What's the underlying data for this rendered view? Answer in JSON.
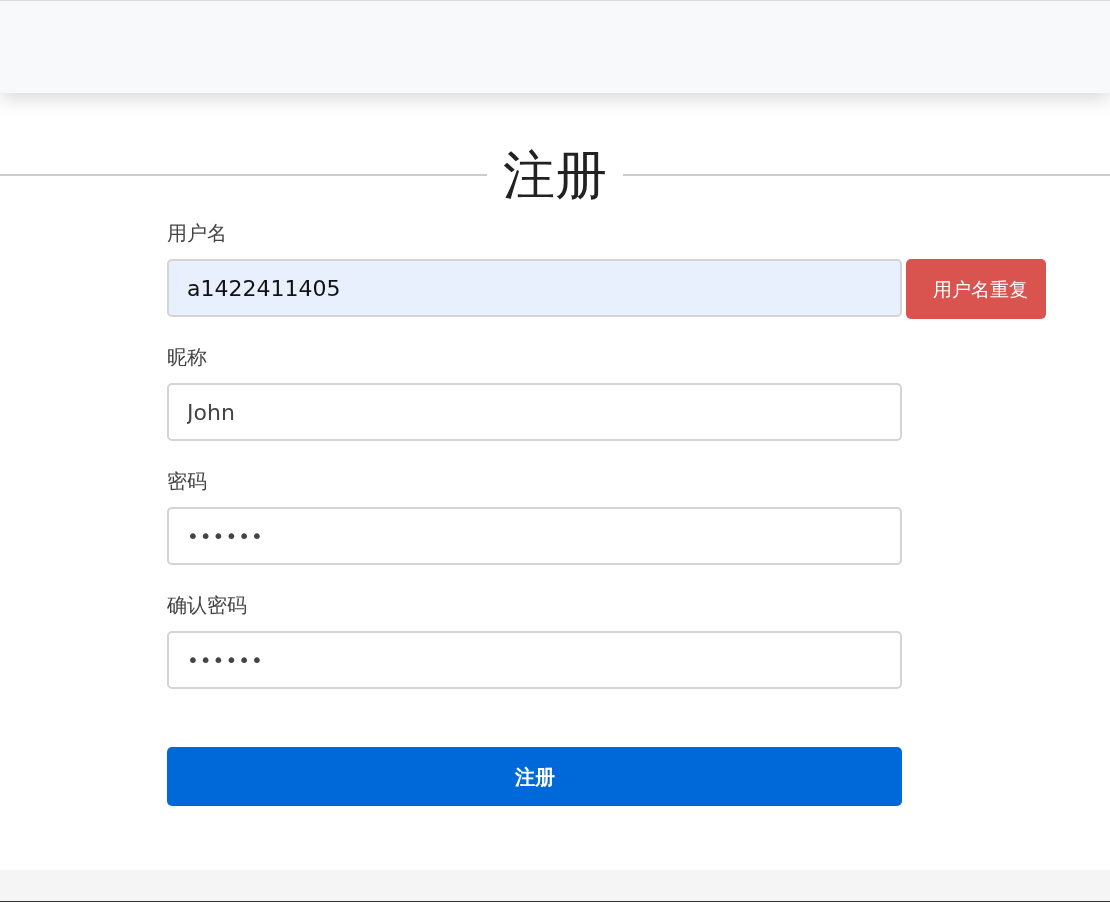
{
  "title": "注册",
  "fields": [
    {
      "label": "用户名",
      "kind": "text",
      "value": "a1422411405",
      "autofilled": true,
      "error": "用户名重复"
    },
    {
      "label": "昵称",
      "kind": "text",
      "value": "John",
      "autofilled": false
    },
    {
      "label": "密码",
      "kind": "password",
      "value": "••••••",
      "autofilled": false
    },
    {
      "label": "确认密码",
      "kind": "password",
      "value": "••••••",
      "autofilled": false
    }
  ],
  "submit": "注册"
}
